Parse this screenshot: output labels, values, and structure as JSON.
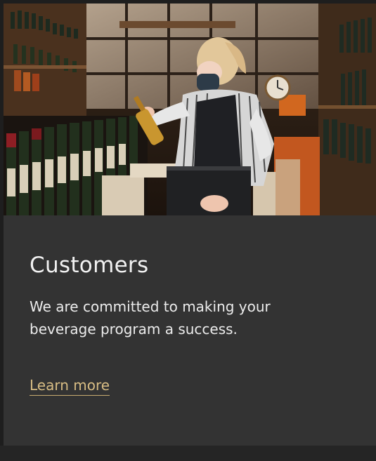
{
  "card": {
    "image_alt": "Masked shop worker holding a wine bottle in a wine store",
    "title": "Customers",
    "description": "We are committed to making your beverage program a success.",
    "link_label": "Learn more"
  },
  "colors": {
    "card_background": "#333333",
    "page_background": "#1e1e1e",
    "link_color": "#d8bd84",
    "text_color": "#f2f2f2"
  }
}
